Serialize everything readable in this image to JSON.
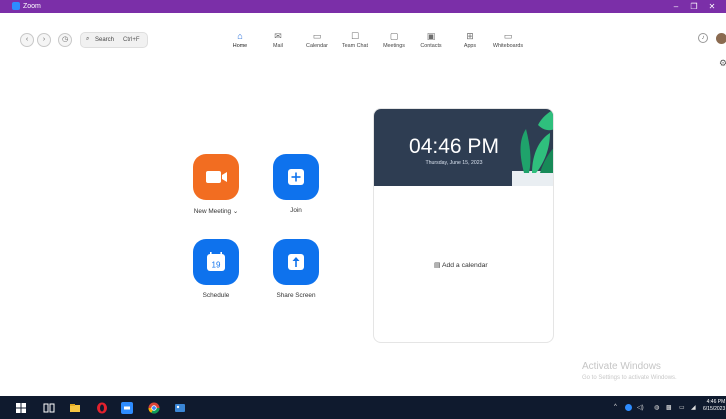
{
  "window": {
    "title": "Zoom"
  },
  "toolbar": {
    "search_label": "Search",
    "search_shortcut": "Ctrl+F",
    "tabs": [
      {
        "label": "Home",
        "icon": "home-icon"
      },
      {
        "label": "Mail",
        "icon": "mail-icon"
      },
      {
        "label": "Calendar",
        "icon": "calendar-icon"
      },
      {
        "label": "Team Chat",
        "icon": "chat-icon"
      },
      {
        "label": "Meetings",
        "icon": "meetings-icon"
      },
      {
        "label": "Contacts",
        "icon": "contacts-icon"
      },
      {
        "label": "Apps",
        "icon": "apps-icon"
      },
      {
        "label": "Whiteboards",
        "icon": "whiteboard-icon"
      }
    ],
    "active_tab": "Home"
  },
  "actions": {
    "new_meeting": "New Meeting",
    "join": "Join",
    "schedule": "Schedule",
    "share_screen": "Share Screen",
    "schedule_day": "19"
  },
  "calendar_card": {
    "time": "04:46 PM",
    "date": "Thursday, June 15, 2023",
    "add_calendar": "Add a calendar"
  },
  "watermark": {
    "line1": "Activate Windows",
    "line2": "Go to Settings to activate Windows."
  },
  "taskbar": {
    "clock_time": "4:46 PM",
    "clock_date": "6/15/2023"
  },
  "colors": {
    "titlebar": "#7b2fa8",
    "zoom_blue": "#0e72ed",
    "new_meeting_orange": "#f26d21",
    "calendar_header": "#2e3d52",
    "taskbar": "#0f1a2e"
  }
}
